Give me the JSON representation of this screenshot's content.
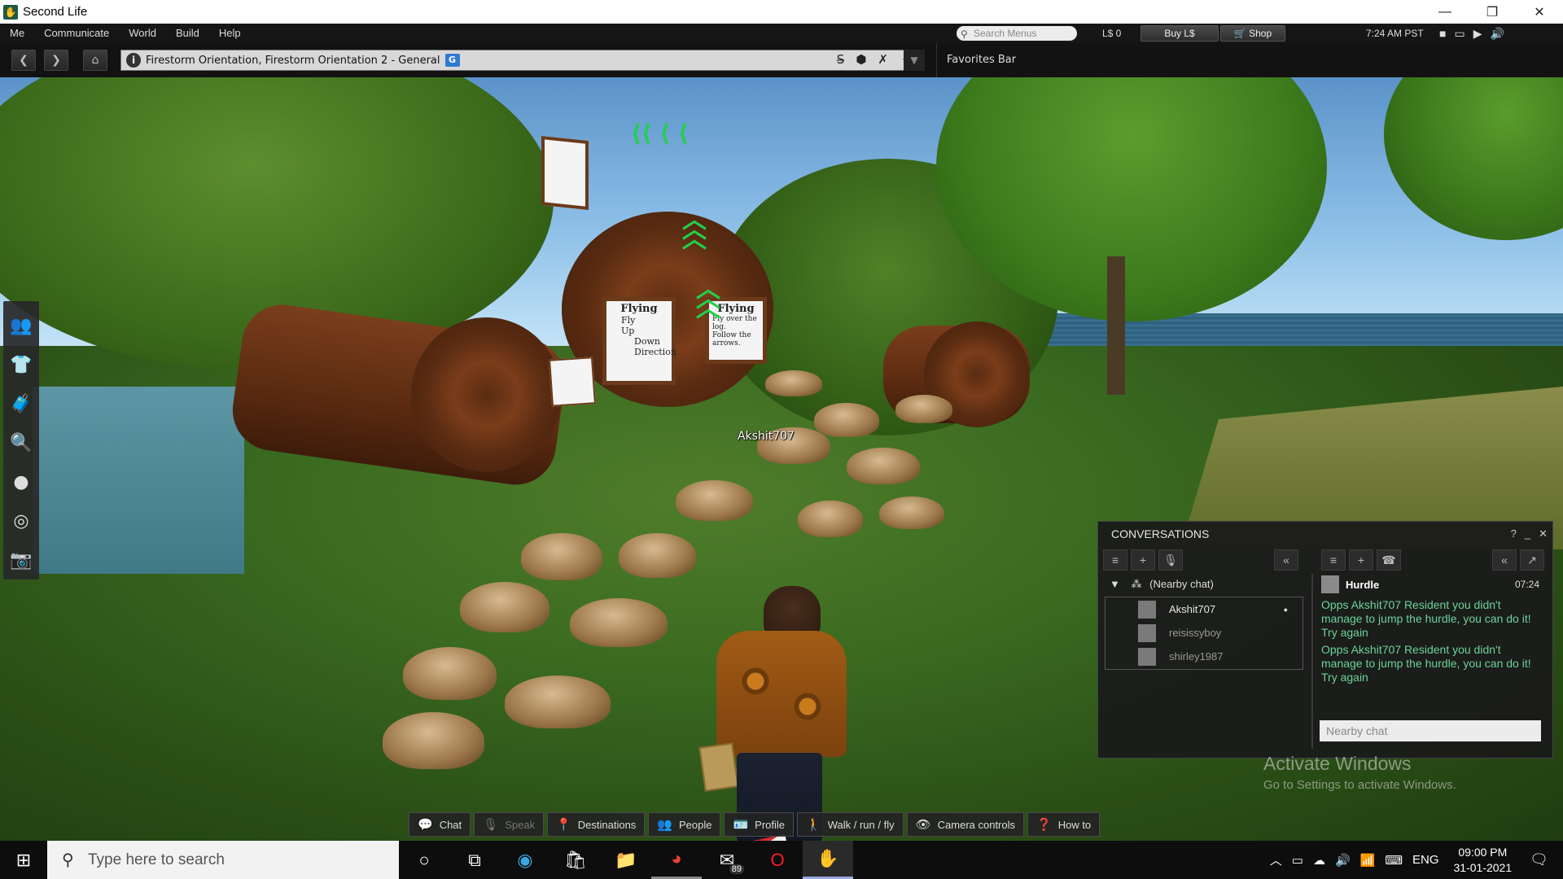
{
  "window": {
    "title": "Second Life",
    "minimize": "—",
    "restore": "❐",
    "close": "✕"
  },
  "menu": {
    "items": [
      "Me",
      "Communicate",
      "World",
      "Build",
      "Help"
    ],
    "search_placeholder": "Search Menus",
    "balance": "L$ 0",
    "buy_label": "Buy L$",
    "shop_label": "Shop",
    "time": "7:24 AM PST"
  },
  "nav": {
    "location": "Firestorm Orientation, Firestorm Orientation 2 - General",
    "maturity": "G",
    "favorites": "Favorites Bar"
  },
  "scene": {
    "avatar_name": "Akshit707",
    "sign1_title": "Flying",
    "sign1_lines": [
      "Fly",
      "Up",
      "Down",
      "Direction"
    ],
    "sign2_title": "Flying",
    "sign2_lines": [
      "Fly over the log.",
      "Follow the arrows."
    ]
  },
  "left_toolbar": {
    "icons": [
      "people-icon",
      "appearance-icon",
      "inventory-icon",
      "search-icon",
      "map-icon",
      "radar-icon",
      "snapshot-icon"
    ]
  },
  "conversations": {
    "title": "CONVERSATIONS",
    "help": "?",
    "minimize": "_",
    "close": "✕",
    "group": "(Nearby chat)",
    "participants": [
      "Akshit707",
      "reisissyboy",
      "shirley1987"
    ],
    "sender": "Hurdle",
    "time": "07:24",
    "messages": [
      "Opps Akshit707 Resident you didn't manage to jump the hurdle, you can do it! Try again",
      "Opps Akshit707 Resident you didn't manage to jump the hurdle, you can do it! Try again"
    ],
    "input_placeholder": "Nearby chat"
  },
  "activate": {
    "line1": "Activate Windows",
    "line2": "Go to Settings to activate Windows."
  },
  "bottom_toolbar": {
    "buttons": [
      {
        "label": "Chat",
        "icon": "chat-icon"
      },
      {
        "label": "Speak",
        "icon": "microphone-icon"
      },
      {
        "label": "Destinations",
        "icon": "map-pin-icon"
      },
      {
        "label": "People",
        "icon": "people-icon"
      },
      {
        "label": "Profile",
        "icon": "profile-icon"
      },
      {
        "label": "Walk / run / fly",
        "icon": "walk-icon"
      },
      {
        "label": "Camera controls",
        "icon": "eye-icon"
      },
      {
        "label": "How to",
        "icon": "help-book-icon"
      }
    ]
  },
  "taskbar": {
    "search_placeholder": "Type here to search",
    "mail_badge": "89",
    "lang": "ENG",
    "time": "09:00 PM",
    "date": "31-01-2021"
  },
  "colors": {
    "chat_text": "#6bd39a",
    "panel_bg": "#1a1a1a"
  }
}
